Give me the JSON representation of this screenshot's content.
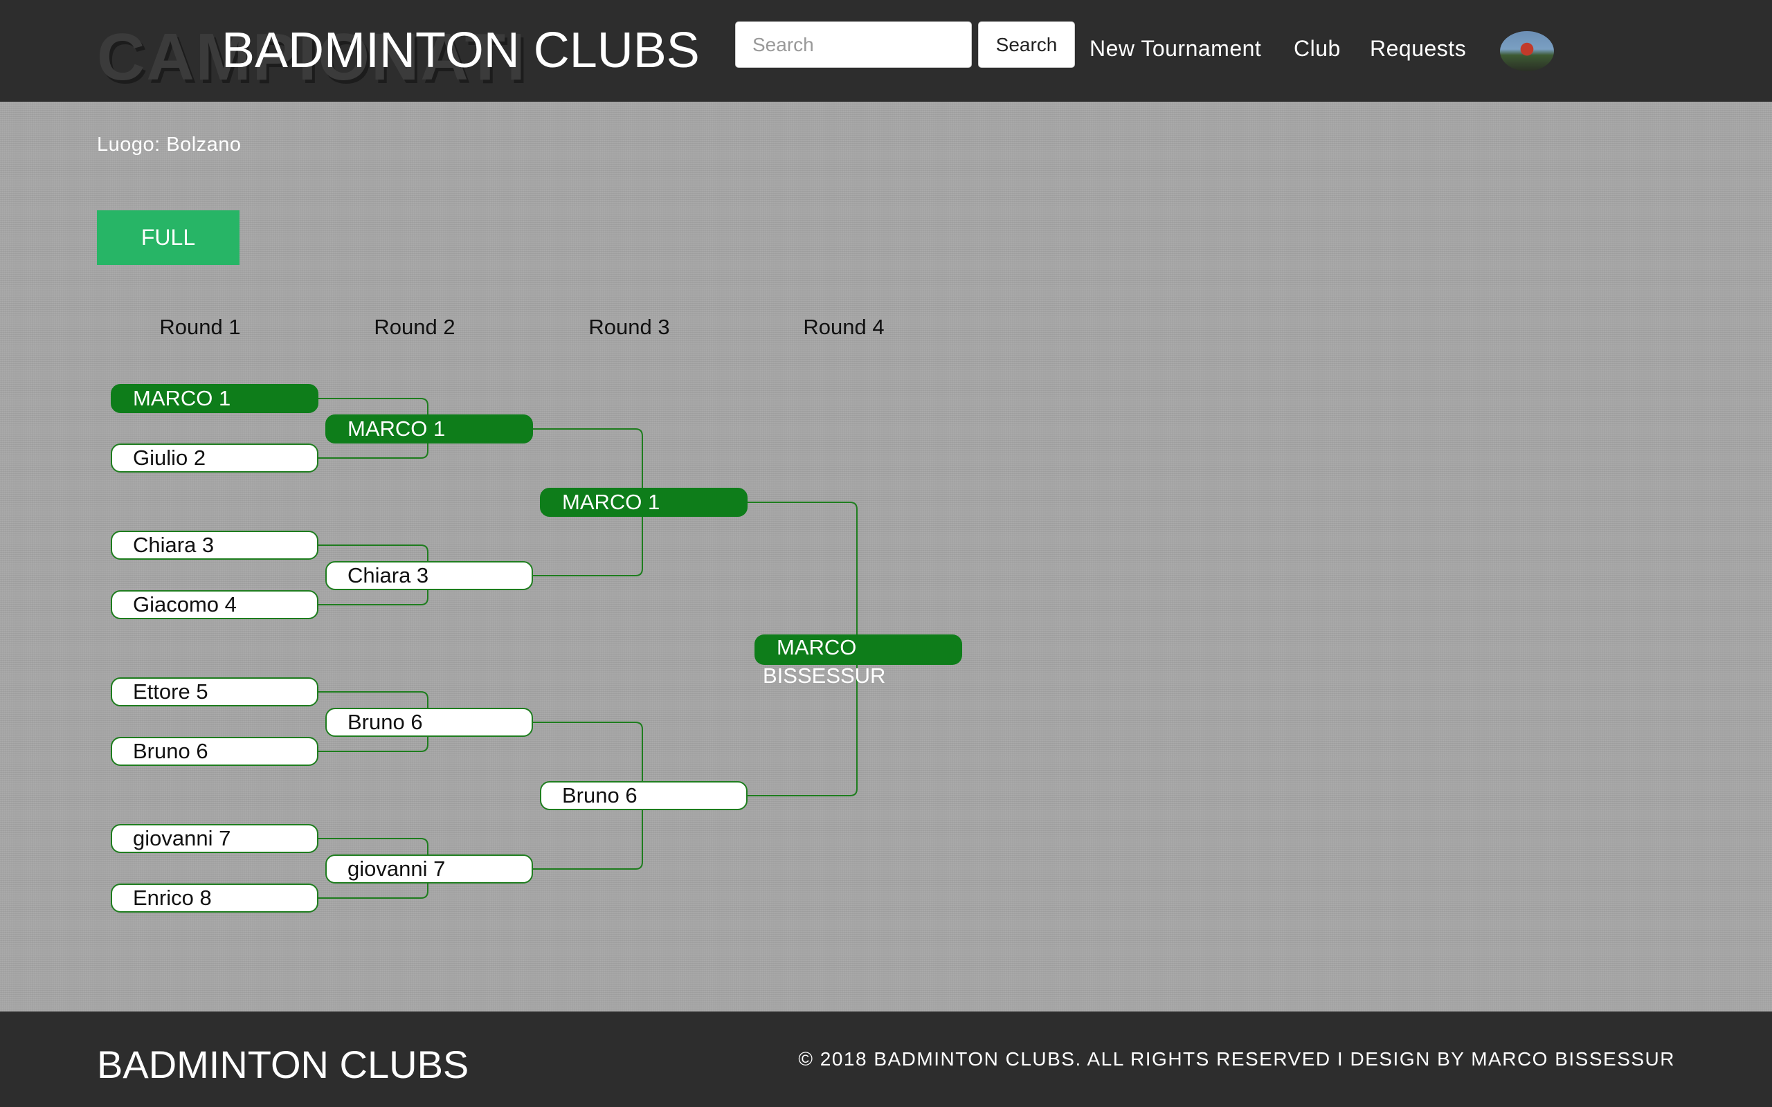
{
  "header": {
    "ghost_title": "CAMPIONATI",
    "site_title": "BADMINTON CLUBS",
    "search_placeholder": "Search",
    "search_button": "Search",
    "nav": [
      "New Tournament",
      "Club",
      "Requests"
    ]
  },
  "tournament": {
    "location": "Luogo: Bolzano",
    "status": "FULL",
    "rounds": [
      "Round 1",
      "Round 2",
      "Round 3",
      "Round 4"
    ],
    "round1": [
      "MARCO 1",
      "Giulio 2",
      "Chiara 3",
      "Giacomo 4",
      "Ettore 5",
      "Bruno 6",
      "giovanni 7",
      "Enrico 8"
    ],
    "round2": [
      "MARCO 1",
      "Chiara 3",
      "Bruno 6",
      "giovanni 7"
    ],
    "round3": [
      "MARCO 1",
      "Bruno 6"
    ],
    "champion": "MARCO BISSESSUR",
    "winner_color": "#0e7d1a",
    "status_color": "#27b566"
  },
  "footer": {
    "title": "BADMINTON CLUBS",
    "copyright": "© 2018 BADMINTON CLUBS. ALL RIGHTS RESERVED I DESIGN BY MARCO BISSESSUR"
  }
}
